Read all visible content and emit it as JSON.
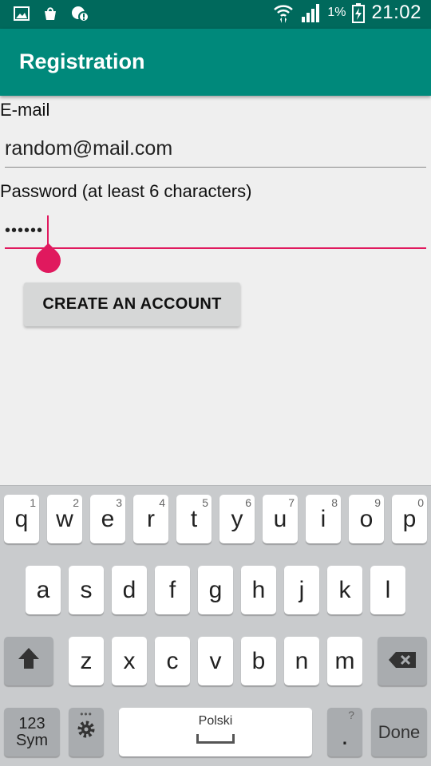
{
  "status_bar": {
    "battery_percent": "1%",
    "time": "21:02",
    "icons": [
      "image-icon",
      "bag-icon",
      "alert-icon",
      "wifi-icon",
      "signal-icon",
      "battery-icon"
    ]
  },
  "app_bar": {
    "title": "Registration"
  },
  "form": {
    "email_label": "E-mail",
    "email_value": "random@mail.com",
    "password_label": "Password (at least 6 characters)",
    "password_value": "••••••",
    "submit_label": "CREATE AN ACCOUNT"
  },
  "keyboard": {
    "row1": [
      {
        "key": "q",
        "num": "1"
      },
      {
        "key": "w",
        "num": "2"
      },
      {
        "key": "e",
        "num": "3"
      },
      {
        "key": "r",
        "num": "4"
      },
      {
        "key": "t",
        "num": "5"
      },
      {
        "key": "y",
        "num": "6"
      },
      {
        "key": "u",
        "num": "7"
      },
      {
        "key": "i",
        "num": "8"
      },
      {
        "key": "o",
        "num": "9"
      },
      {
        "key": "p",
        "num": "0"
      }
    ],
    "row2": [
      "a",
      "s",
      "d",
      "f",
      "g",
      "h",
      "j",
      "k",
      "l"
    ],
    "row3": [
      "z",
      "x",
      "c",
      "v",
      "b",
      "n",
      "m"
    ],
    "sym_label_line1": "123",
    "sym_label_line2": "Sym",
    "space_label": "Polski",
    "period": ".",
    "period_hint": "?",
    "done_label": "Done",
    "colors": {
      "accent": "#e0195e",
      "status_bar": "#00695c",
      "app_bar": "#00897b"
    }
  }
}
